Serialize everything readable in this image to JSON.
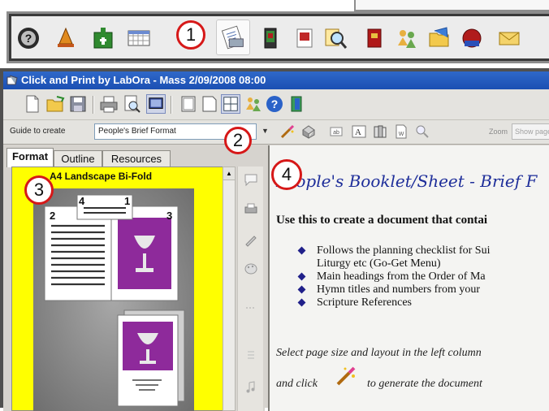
{
  "window": {
    "title": "Click and Print by LabOra - Mass 2/09/2008 08:00"
  },
  "callouts": [
    "1",
    "2",
    "3",
    "4"
  ],
  "launcher_icons": [
    "help-icon",
    "bell-icon",
    "church-calendar-icon",
    "calendar-grid-icon",
    "print-document-icon",
    "book-icon",
    "document-icon",
    "search-icon",
    "red-book-icon",
    "people-icon",
    "open-folder-icon",
    "globe-icon",
    "envelope-icon"
  ],
  "toolbar1_icons": [
    "new-document-icon",
    "open-folder-icon",
    "save-icon",
    "print-icon",
    "print-preview-icon",
    "screen-icon",
    "page-icon",
    "page-alt-icon",
    "grid-icon",
    "people-icon",
    "help-icon",
    "exit-icon"
  ],
  "toolbar2": {
    "guide_label": "Guide to create",
    "guide_value": "People's Brief Format",
    "zoom_label": "Zoom",
    "zoom_value": "Show page"
  },
  "tabs": [
    {
      "label": "Format",
      "active": true
    },
    {
      "label": "Outline",
      "active": false
    },
    {
      "label": "Resources",
      "active": false
    }
  ],
  "format_list": {
    "selected_item": "A4 Landscape Bi-Fold",
    "preview_numbers": [
      "4",
      "1",
      "2",
      "3"
    ]
  },
  "document": {
    "title": "People's Booklet/Sheet - Brief F",
    "lead": "Use this to create a document that contai",
    "bullets": [
      "Follows the planning checklist for Sui",
      "Liturgy etc (Go-Get Menu)",
      "Main headings from the Order of Ma",
      "Hymn titles and numbers from your",
      "Scripture References"
    ],
    "footer_line1": "Select page size and layout in the left column",
    "footer_line2_pre": "and click",
    "footer_line2_post": "to generate the document"
  },
  "colors": {
    "title_bar": "#1b4fb2",
    "callout_ring": "#d61818",
    "format_list_bg": "#ffff00",
    "doc_title": "#1e2e9a",
    "preview_purple": "#8e2a9b"
  }
}
